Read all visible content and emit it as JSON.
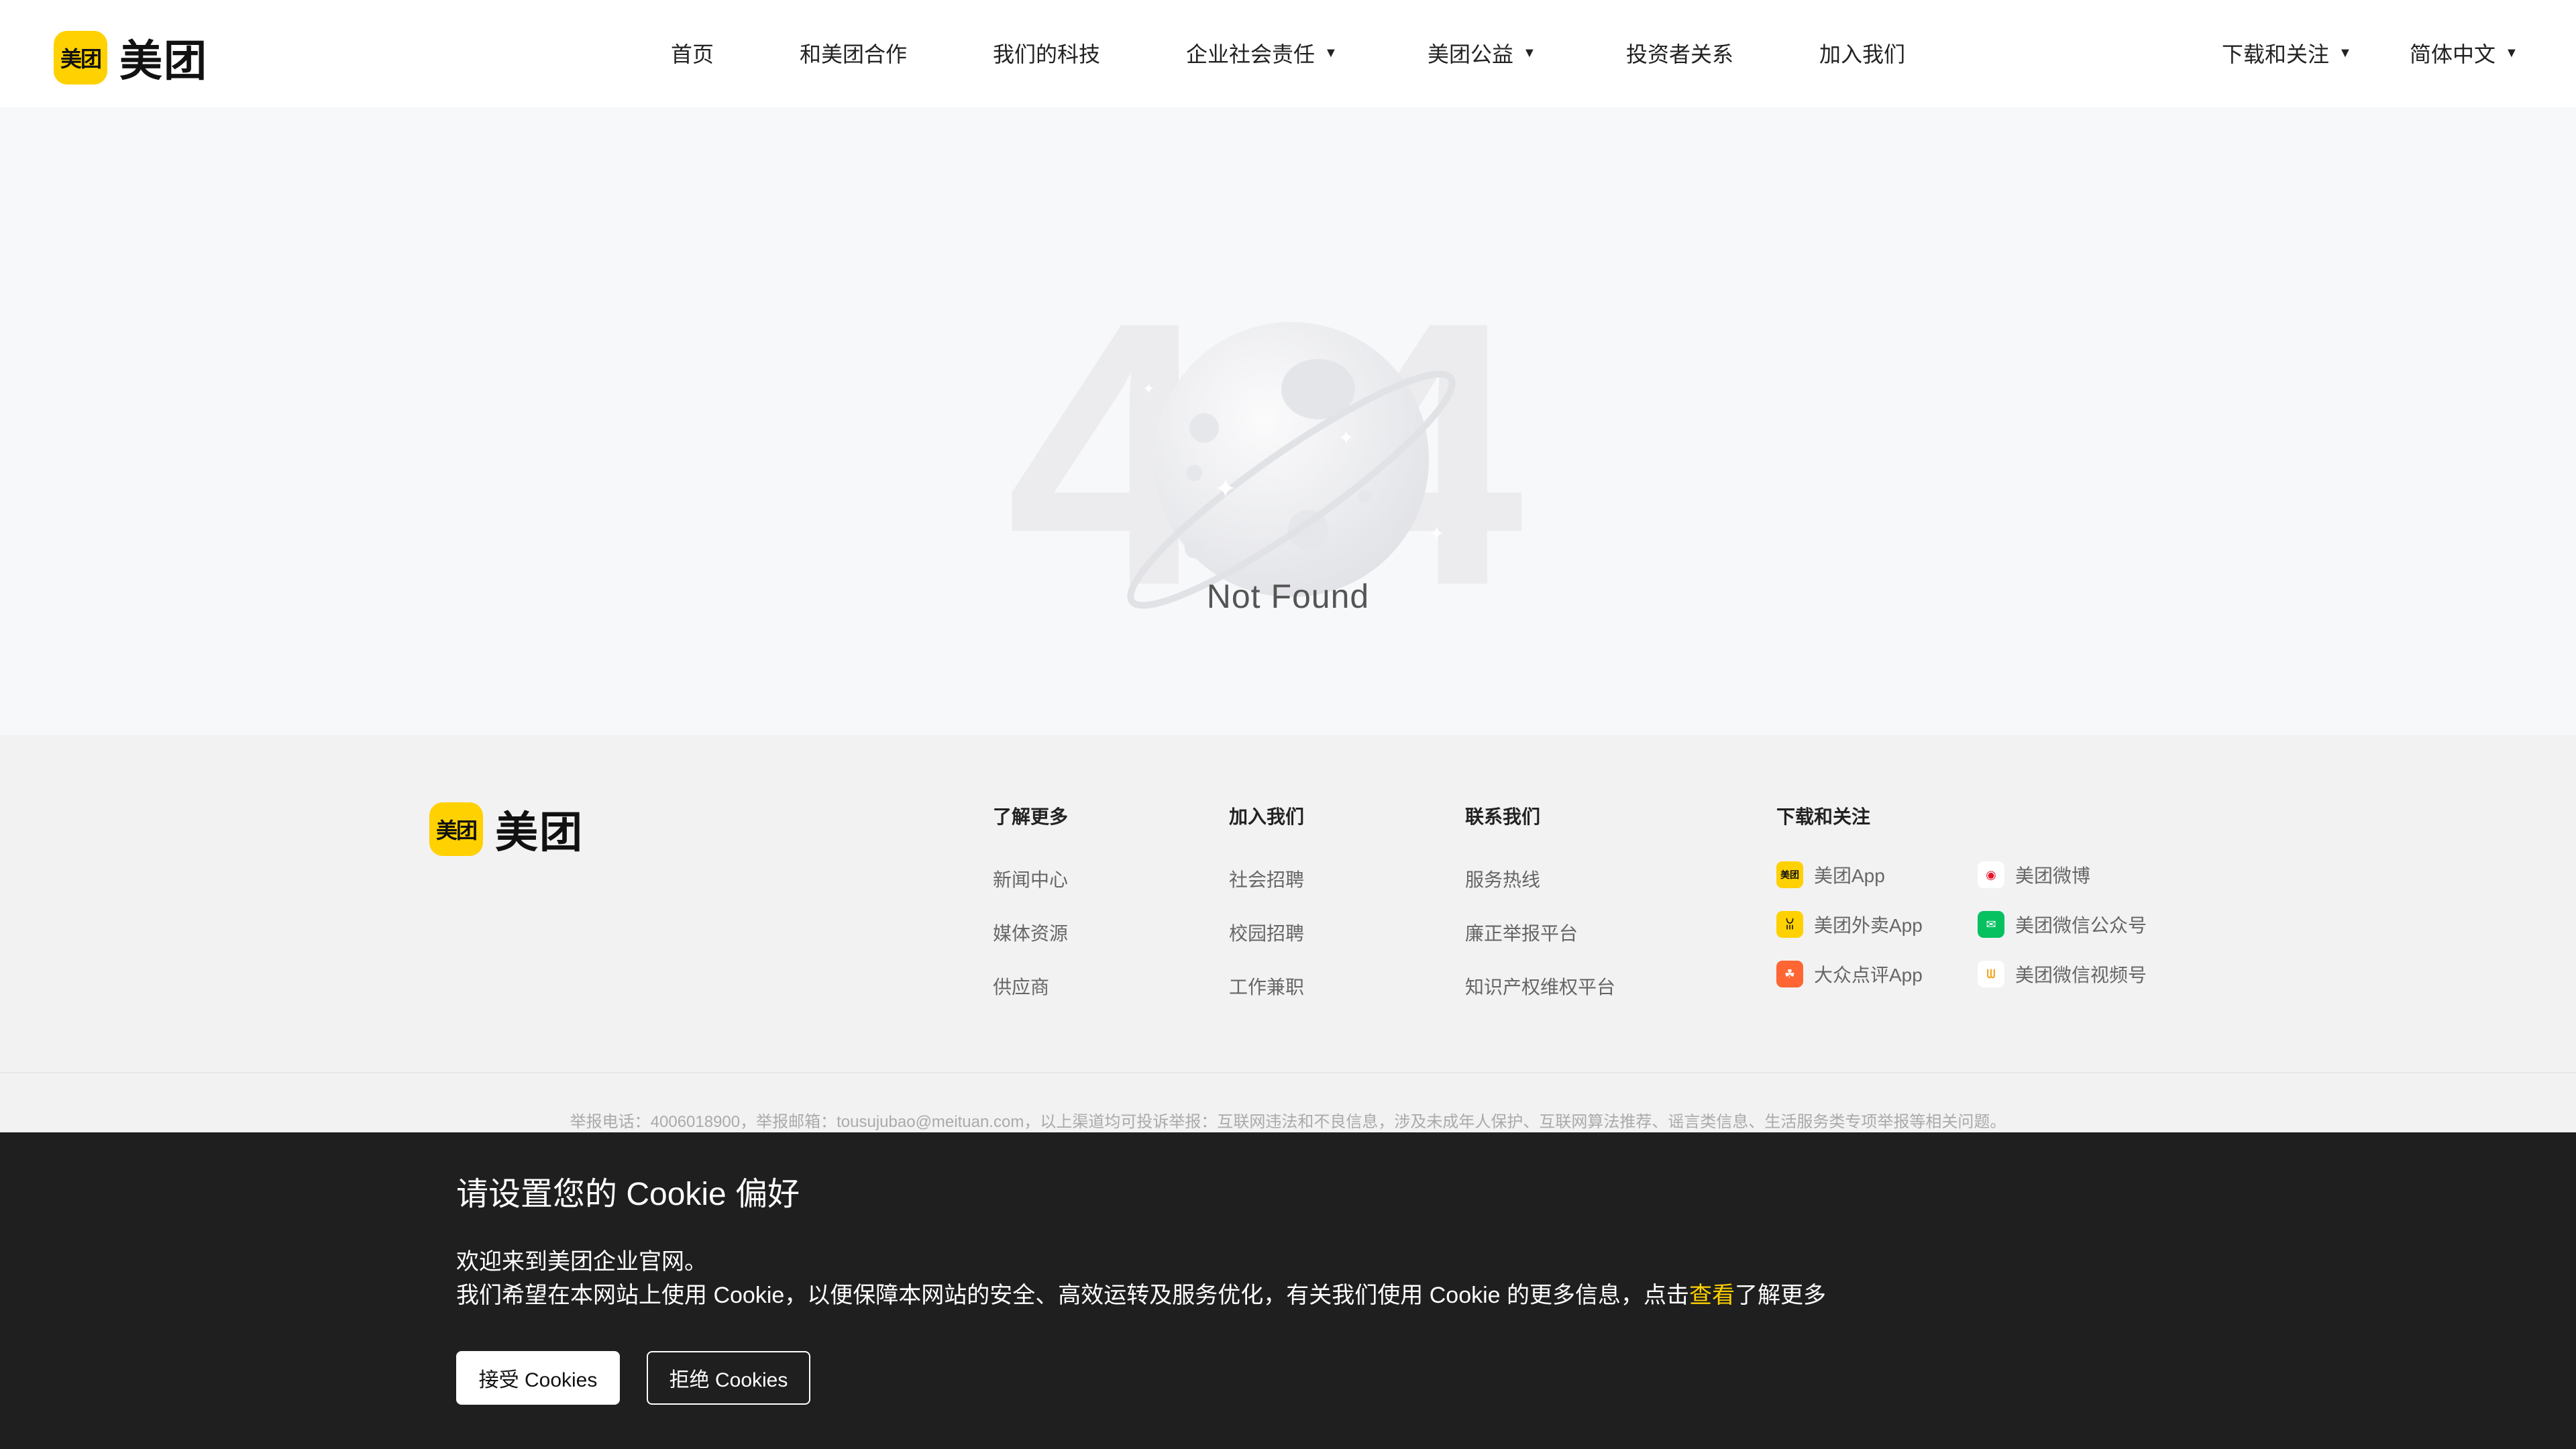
{
  "brand": {
    "logo_mark": "美团",
    "logo_word": "美团"
  },
  "nav": {
    "items": [
      {
        "label": "首页"
      },
      {
        "label": "和美团合作"
      },
      {
        "label": "我们的科技"
      },
      {
        "label": "企业社会责任",
        "dropdown": true
      },
      {
        "label": "美团公益",
        "dropdown": true
      },
      {
        "label": "投资者关系"
      },
      {
        "label": "加入我们"
      }
    ],
    "right": [
      {
        "label": "下载和关注",
        "dropdown": true
      },
      {
        "label": "简体中文",
        "dropdown": true
      }
    ],
    "caret": "▼"
  },
  "error": {
    "code_left": "4",
    "code_right": "4",
    "message": "Not Found"
  },
  "footer": {
    "columns": [
      {
        "title": "了解更多",
        "links": [
          "新闻中心",
          "媒体资源",
          "供应商"
        ]
      },
      {
        "title": "加入我们",
        "links": [
          "社会招聘",
          "校园招聘",
          "工作兼职"
        ]
      },
      {
        "title": "联系我们",
        "links": [
          "服务热线",
          "廉正举报平台",
          "知识产权维权平台"
        ]
      }
    ],
    "social": {
      "title": "下载和关注",
      "items": [
        {
          "label": "美团App",
          "icon": "meituan-app-icon",
          "icon_text": "美团",
          "color": "#ffd100",
          "fg": "#111"
        },
        {
          "label": "美团微博",
          "icon": "weibo-icon",
          "icon_text": "◉",
          "color": "#ffffff",
          "fg": "#e6162d"
        },
        {
          "label": "美团外卖App",
          "icon": "waimai-app-icon",
          "icon_text": "ꈍ",
          "color": "#ffd100",
          "fg": "#111"
        },
        {
          "label": "美团微信公众号",
          "icon": "wechat-icon",
          "icon_text": "✉",
          "color": "#07c160",
          "fg": "#fff"
        },
        {
          "label": "大众点评App",
          "icon": "dianping-app-icon",
          "icon_text": "☘",
          "color": "#ff6633",
          "fg": "#fff"
        },
        {
          "label": "美团微信视频号",
          "icon": "wechat-channels-icon",
          "icon_text": "ᗯ",
          "color": "#ffffff",
          "fg": "#f5a623"
        }
      ]
    },
    "notice": "举报电话：4006018900，举报邮箱：tousujubao@meituan.com，以上渠道均可投诉举报：互联网违法和不良信息，涉及未成年人保护、互联网算法推荐、谣言类信息、生活服务类专项举报等相关问题。"
  },
  "cookie": {
    "title": "请设置您的 Cookie 偏好",
    "line1": "欢迎来到美团企业官网。",
    "line2_before": "我们希望在本网站上使用 Cookie，以便保障本网站的安全、高效运转及服务优化，有关我们使用 Cookie 的更多信息，点击",
    "link": "查看",
    "line2_after": "了解更多",
    "accept": "接受 Cookies",
    "reject": "拒绝 Cookies"
  },
  "colors": {
    "brand_yellow": "#ffd100",
    "banner_bg": "#1f1f1f",
    "page_bg": "#f7f8fa"
  }
}
